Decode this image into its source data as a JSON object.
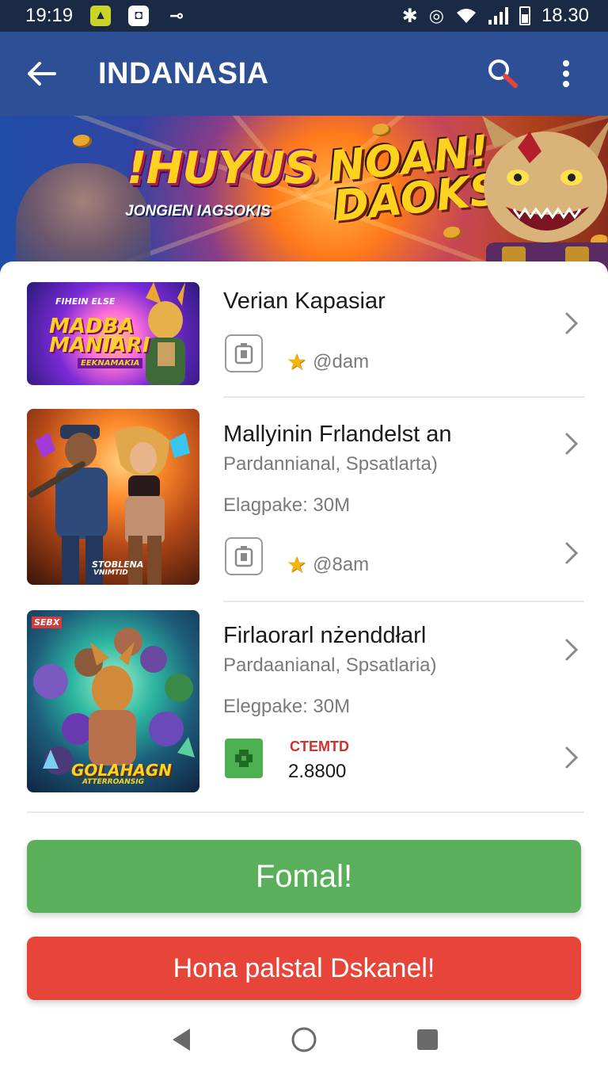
{
  "status_bar": {
    "time": "19:19",
    "right_time": "18.30",
    "icons": [
      "app-icon",
      "shield-icon",
      "key-icon",
      "bluetooth-icon",
      "vibrate-icon",
      "wifi-icon",
      "signal-icon",
      "battery-icon"
    ]
  },
  "app_bar": {
    "title": "INDANASIA",
    "icons": [
      "back-arrow-icon",
      "search-icon",
      "more-vert-icon"
    ]
  },
  "banner": {
    "logo": "!HUYUS",
    "subtitle": "JONGIEN IAGSOKIS",
    "shout_line1": "NOAN!",
    "shout_line2": "DAOKS!"
  },
  "items": [
    {
      "thumb_title": "MADBA MANIARI",
      "thumb_top": "FIHEIN ELSE",
      "thumb_sub": "EEKNAMAKIA",
      "title": "Verian Kapasiar",
      "rating": "@dam",
      "icon": "app-badge-icon"
    },
    {
      "thumb_title": "STOBLENA",
      "thumb_sub": "VNIMTID",
      "title": "Mallyinin Frlandelst an",
      "subtitle": "Pardannianal, Spsatlarta)",
      "size": "Elagpake: 30M",
      "rating": "@8am",
      "icon": "app-badge-icon"
    },
    {
      "thumb_title": "GOLAHAGN",
      "thumb_tag": "SEBX",
      "thumb_sub": "ATTERROANSIG",
      "title": "Firlaorarl nżenddłarl",
      "subtitle": "Pardaanianal, Spsatlaria)",
      "size": "Elegpake: 30M",
      "price_label": "CTEMTD",
      "price": "2.8800",
      "icon": "green-app-icon"
    }
  ],
  "buttons": {
    "primary": "Fomal!",
    "secondary": "Hona palstal Dskanel!"
  },
  "nav": {
    "icons": [
      "back-triangle-icon",
      "home-circle-icon",
      "recents-square-icon"
    ]
  },
  "colors": {
    "status_bar": "#1b2a44",
    "app_bar": "#2d4f95",
    "primary_button": "#5ab05a",
    "secondary_button": "#e8453a",
    "price_label": "#d32f2f"
  }
}
